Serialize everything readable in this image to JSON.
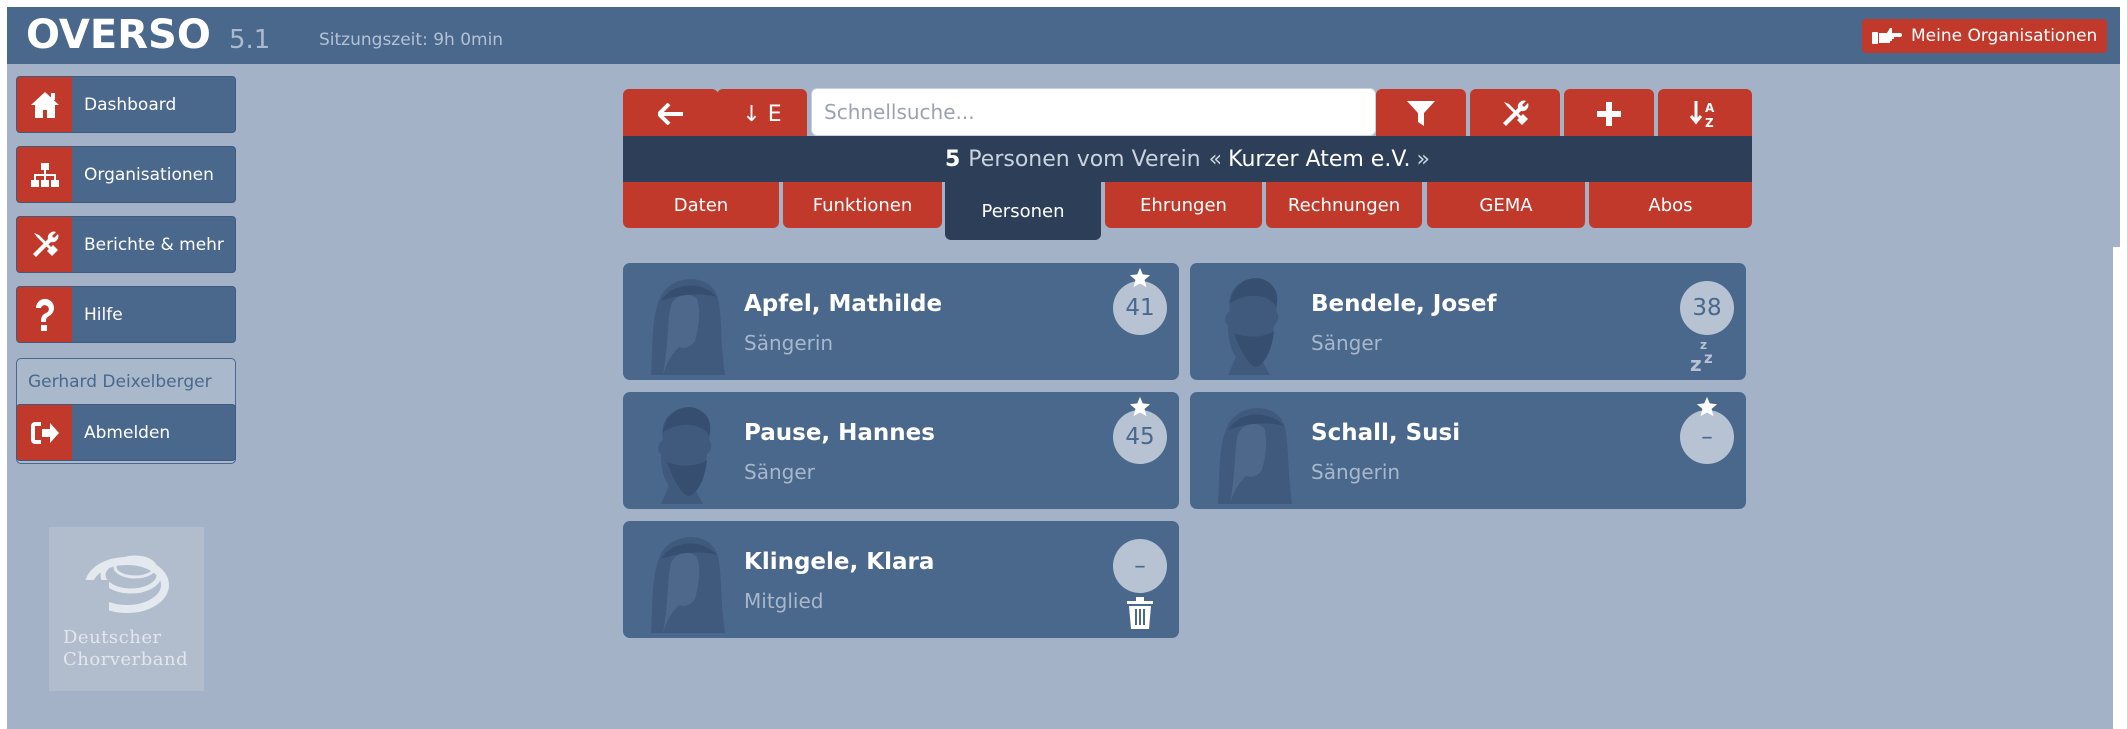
{
  "header": {
    "logo": "OVERSO",
    "version": "5.1",
    "session": "Sitzungszeit: 9h 0min",
    "org_button": "Meine Organisationen"
  },
  "sidebar": {
    "items": [
      {
        "label": "Dashboard",
        "icon": "home-icon"
      },
      {
        "label": "Organisationen",
        "icon": "org-chart-icon"
      },
      {
        "label": "Berichte & mehr",
        "icon": "tools-icon"
      },
      {
        "label": "Hilfe",
        "icon": "question-icon"
      }
    ],
    "user_name": "Gerhard Deixelberger",
    "logout_label": "Abmelden",
    "partner_logo_line1": "Deutscher",
    "partner_logo_line2": "Chorverband"
  },
  "toolbar": {
    "back_icon": "arrow-left-icon",
    "sort_label": "↓ E",
    "search_placeholder": "Schnellsuche...",
    "search_value": "",
    "filter_icon": "filter-icon",
    "tools_icon": "tools-icon",
    "add_icon": "plus-icon",
    "sort_az_icon": "sort-az-icon"
  },
  "title": {
    "count": "5",
    "text": "Personen vom Verein",
    "quote_open": "«",
    "club": "Kurzer Atem e.V.",
    "quote_close": "»"
  },
  "tabs": [
    {
      "label": "Daten",
      "active": false
    },
    {
      "label": "Funktionen",
      "active": false
    },
    {
      "label": "Personen",
      "active": true
    },
    {
      "label": "Ehrungen",
      "active": false
    },
    {
      "label": "Rechnungen",
      "active": false
    },
    {
      "label": "GEMA",
      "active": false
    },
    {
      "label": "Abos",
      "active": false
    }
  ],
  "persons": [
    {
      "name": "Apfel, Mathilde",
      "role": "Sängerin",
      "badge": "41",
      "star": true,
      "sleep": false,
      "trash": false,
      "gender": "female"
    },
    {
      "name": "Bendele, Josef",
      "role": "Sänger",
      "badge": "38",
      "star": false,
      "sleep": true,
      "trash": false,
      "gender": "male"
    },
    {
      "name": "Pause, Hannes",
      "role": "Sänger",
      "badge": "45",
      "star": true,
      "sleep": false,
      "trash": false,
      "gender": "male"
    },
    {
      "name": "Schall, Susi",
      "role": "Sängerin",
      "badge": "–",
      "star": true,
      "sleep": false,
      "trash": false,
      "gender": "female"
    },
    {
      "name": "Klingele, Klara",
      "role": "Mitglied",
      "badge": "–",
      "star": false,
      "sleep": false,
      "trash": true,
      "gender": "female"
    }
  ],
  "colors": {
    "primary": "#4a678c",
    "accent": "#c0392b",
    "dark": "#2d3f58",
    "background": "#a3b2c6"
  }
}
